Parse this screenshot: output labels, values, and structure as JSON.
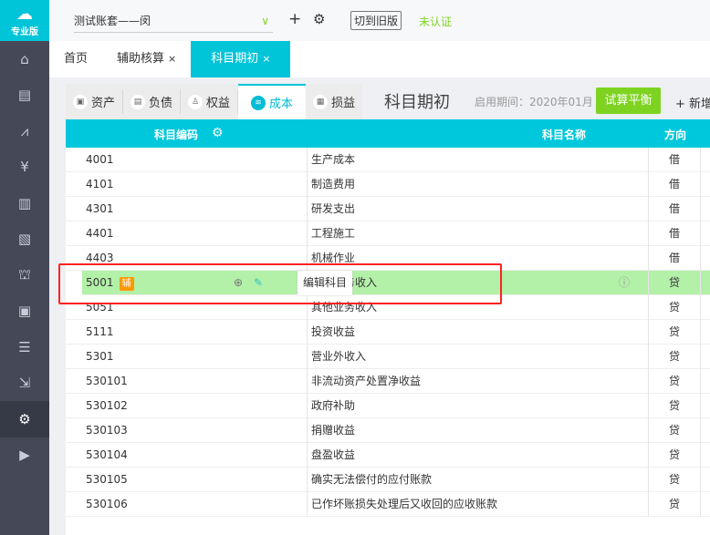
{
  "sidebar": {
    "logo": "专业版",
    "items": [
      "home",
      "voucher",
      "report",
      "money",
      "ledger",
      "chart",
      "shop",
      "invoice",
      "coins",
      "export",
      "settings",
      "video"
    ]
  },
  "header": {
    "account": "测试账套——闵",
    "switch_old": "切到旧版",
    "auth_status": "未认证"
  },
  "tabs": [
    {
      "label": "首页"
    },
    {
      "label": "辅助核算",
      "close": "×"
    },
    {
      "label": "科目期初",
      "close": "×"
    }
  ],
  "subtabs": [
    {
      "label": "资产"
    },
    {
      "label": "负债"
    },
    {
      "label": "权益"
    },
    {
      "label": "成本"
    },
    {
      "label": "损益"
    }
  ],
  "page": {
    "title": "科目期初",
    "period": "启用期间：2020年01月",
    "trial_balance": "试算平衡",
    "add": "+ 新增"
  },
  "table": {
    "headers": [
      "科目编码",
      "科目名称",
      "方向"
    ],
    "rows": [
      [
        "4001",
        "生产成本",
        "借"
      ],
      [
        "4101",
        "制造费用",
        "借"
      ],
      [
        "4301",
        "研发支出",
        "借"
      ],
      [
        "4401",
        "工程施工",
        "借"
      ],
      [
        "4403",
        "机械作业",
        "借"
      ],
      [
        "5001",
        "主营业务收入",
        "贷"
      ],
      [
        "5051",
        "其他业务收入",
        "贷"
      ],
      [
        "5111",
        "投资收益",
        "贷"
      ],
      [
        "5301",
        "营业外收入",
        "贷"
      ],
      [
        "530101",
        "非流动资产处置净收益",
        "贷"
      ],
      [
        "530102",
        "政府补助",
        "贷"
      ],
      [
        "530103",
        "捐赠收益",
        "贷"
      ],
      [
        "530104",
        "盘盈收益",
        "贷"
      ],
      [
        "530105",
        "确实无法偿付的应付账款",
        "贷"
      ],
      [
        "530106",
        "已作坏账损失处理后又收回的应收账款",
        "贷"
      ]
    ],
    "badge": "辅",
    "tooltip": "编辑科目"
  }
}
